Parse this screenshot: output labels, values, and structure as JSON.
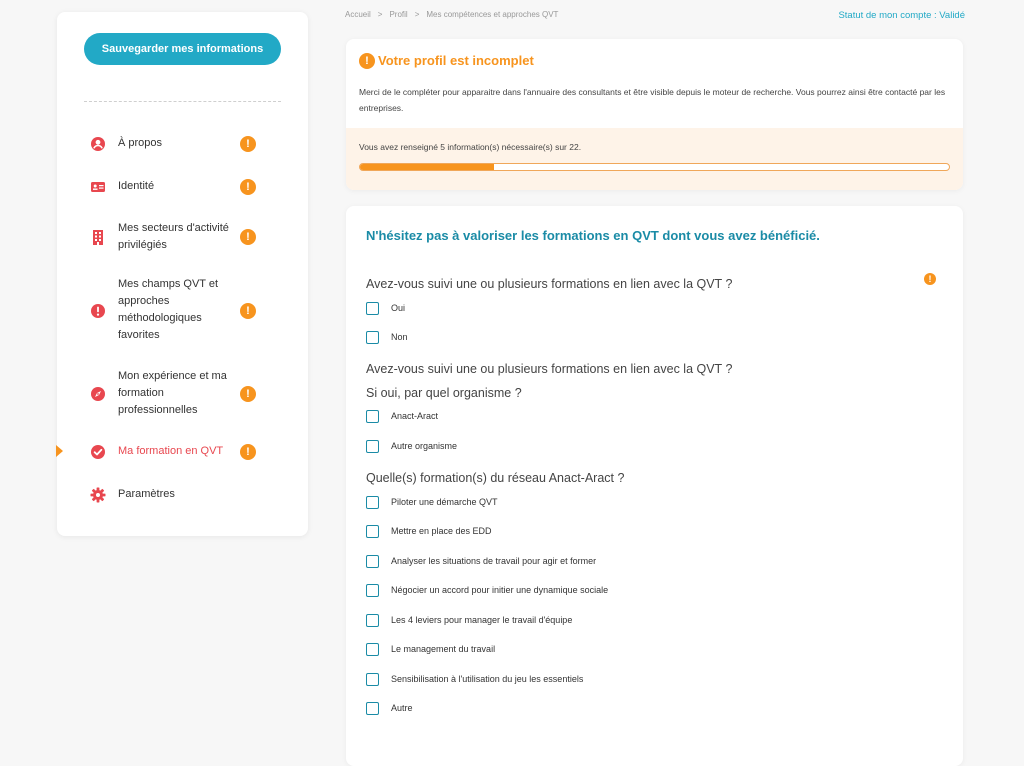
{
  "sidebar": {
    "save_label": "Sauvegarder mes informations",
    "items": [
      {
        "label": "À propos",
        "icon": "user-icon"
      },
      {
        "label": "Identité",
        "icon": "id-card-icon"
      },
      {
        "label": "Mes secteurs d'activité privilégiés",
        "icon": "building-icon"
      },
      {
        "label": "Mes champs QVT et approches méthodologiques favorites",
        "icon": "info-icon"
      },
      {
        "label": "Mon expérience et ma formation professionnelles",
        "icon": "compass-icon"
      },
      {
        "label": "Ma formation en QVT",
        "icon": "check-circle-icon",
        "active": true
      },
      {
        "label": "Paramètres",
        "icon": "gear-icon"
      }
    ],
    "warning_glyph": "!"
  },
  "breadcrumb": [
    "Accueil",
    ">",
    "Profil",
    ">",
    "Mes compétences et approches QVT"
  ],
  "account_status": "Statut de mon compte : Validé",
  "alert": {
    "icon_glyph": "!",
    "title": "Votre profil est incomplet",
    "text": "Merci de le compléter pour apparaitre dans l'annuaire des consultants et être visible depuis le moteur de recherche. Vous pourrez ainsi être contacté par les entreprises.",
    "progress_text": "Vous avez renseigné 5 information(s) nécessaire(s) sur 22.",
    "progress_done": 5,
    "progress_total": 22
  },
  "form": {
    "heading": "N'hésitez pas à valoriser les formations en QVT dont vous avez bénéficié.",
    "warning_glyph": "!",
    "q1": "Avez-vous suivi une ou plusieurs formations en lien avec la QVT ?",
    "q1_options": [
      "Oui",
      "Non"
    ],
    "q2_line1": "Avez-vous suivi une ou plusieurs formations en lien avec la QVT ?",
    "q2_line2": "Si oui, par quel organisme ?",
    "q2_options": [
      "Anact-Aract",
      "Autre organisme"
    ],
    "q3": "Quelle(s) formation(s) du réseau Anact-Aract ?",
    "q3_options": [
      "Piloter une démarche QVT",
      "Mettre en place des EDD",
      "Analyser les situations de travail pour agir et former",
      "Négocier un accord pour initier une dynamique sociale",
      "Les 4 leviers pour manager le travail d'équipe",
      "Le management du travail",
      "Sensibilisation à l'utilisation du jeu les essentiels",
      "Autre"
    ]
  },
  "colors": {
    "accent": "#22a9c6",
    "heading_teal": "#1a8ba6",
    "warning_orange": "#f7941e",
    "icon_red": "#e8474f",
    "alert_bg": "#fef3e8"
  }
}
